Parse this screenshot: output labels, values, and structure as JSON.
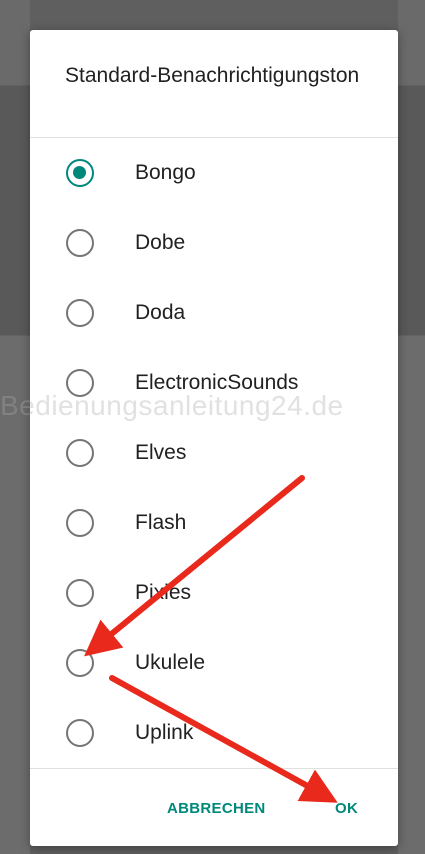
{
  "dialog": {
    "title": "Standard-Benachrichtigungston",
    "options": [
      {
        "label": "Bongo",
        "checked": true
      },
      {
        "label": "Dobe",
        "checked": false
      },
      {
        "label": "Doda",
        "checked": false
      },
      {
        "label": "ElectronicSounds",
        "checked": false
      },
      {
        "label": "Elves",
        "checked": false
      },
      {
        "label": "Flash",
        "checked": false
      },
      {
        "label": "Pixies",
        "checked": false
      },
      {
        "label": "Ukulele",
        "checked": false
      },
      {
        "label": "Uplink",
        "checked": false
      }
    ],
    "cancel_label": "ABBRECHEN",
    "ok_label": "OK"
  },
  "watermark": "Bedienungsanleitung24.de",
  "colors": {
    "accent": "#00897b",
    "arrow": "#e8291c",
    "backdrop": "#5f5f5f"
  }
}
